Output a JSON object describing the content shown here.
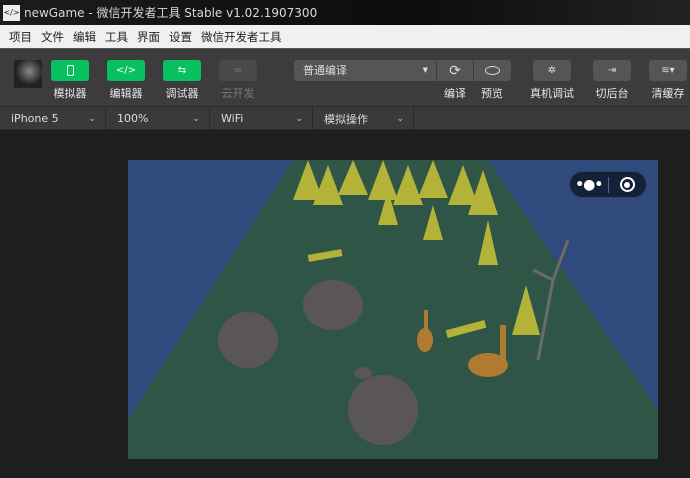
{
  "window": {
    "icon": "</>",
    "title": "newGame - 微信开发者工具 Stable v1.02.1907300"
  },
  "menu": [
    "项目",
    "文件",
    "编辑",
    "工具",
    "界面",
    "设置",
    "微信开发者工具"
  ],
  "toolbar": {
    "simulator": "模拟器",
    "editor": "编辑器",
    "debugger": "调试器",
    "cloud": "云开发",
    "compile_mode": "普通编译",
    "compile": "编译",
    "preview": "预览",
    "remote_debug": "真机调试",
    "background": "切后台",
    "clear_cache": "清缓存"
  },
  "device_bar": {
    "device": "iPhone 5",
    "zoom": "100%",
    "network": "WiFi",
    "operation": "模拟操作"
  },
  "capsule": {
    "more": "•●•"
  },
  "colors": {
    "accent": "#07c160",
    "sky": "#2f4a7d",
    "ground": "#2e5545"
  }
}
